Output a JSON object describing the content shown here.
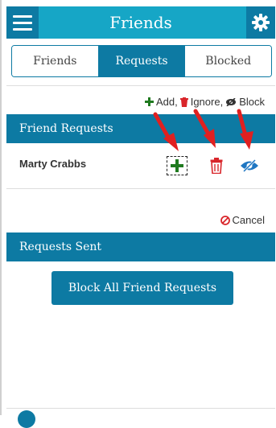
{
  "header": {
    "title": "Friends"
  },
  "tabs": [
    {
      "label": "Friends",
      "active": false
    },
    {
      "label": "Requests",
      "active": true
    },
    {
      "label": "Blocked",
      "active": false
    }
  ],
  "legend": {
    "add_label": "Add,",
    "ignore_label": "Ignore,",
    "block_label": "Block"
  },
  "friend_requests": {
    "title": "Friend Requests",
    "items": [
      {
        "name": "Marty Crabbs"
      }
    ]
  },
  "cancel_label": "Cancel",
  "requests_sent": {
    "title": "Requests Sent"
  },
  "block_all_label": "Block All Friend Requests",
  "colors": {
    "primary": "#0d7aa3",
    "header_bar": "#16a6c6",
    "add_green": "#1f7a1f",
    "ignore_red": "#d9262b",
    "block_blue": "#1f76c2",
    "annotation_arrow": "#e02020"
  },
  "icons": [
    "menu-icon",
    "gear-icon",
    "plus-icon",
    "trash-icon",
    "eye-slash-icon",
    "cancel-circle-icon"
  ]
}
